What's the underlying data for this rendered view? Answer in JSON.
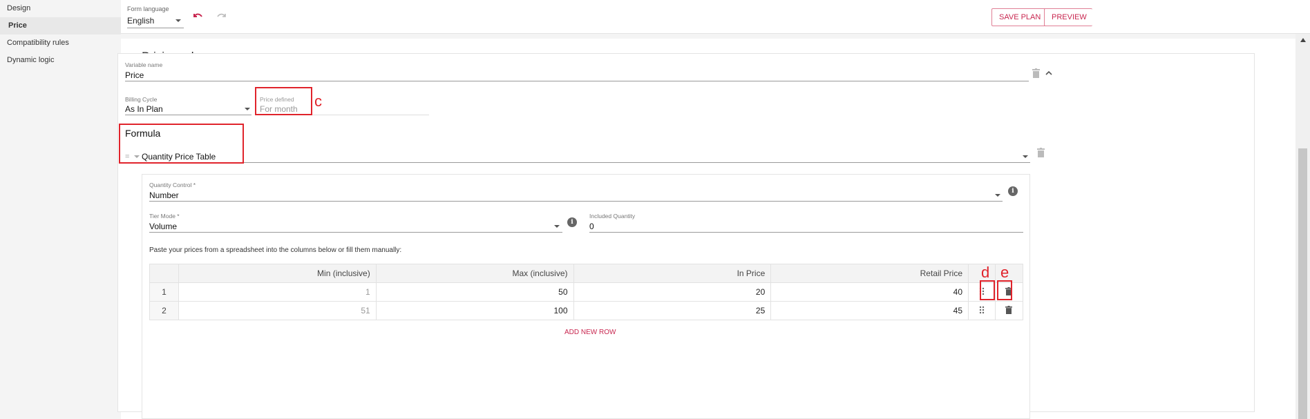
{
  "sidebar": {
    "items": [
      {
        "label": "Design"
      },
      {
        "label": "Price"
      },
      {
        "label": "Compatibility rules"
      },
      {
        "label": "Dynamic logic"
      }
    ]
  },
  "topbar": {
    "language_label": "Form language",
    "language_value": "English",
    "save_plan_label": "SAVE PLAN",
    "preview_label": "PREVIEW"
  },
  "main": {
    "title": "Pricing rules",
    "variable_label": "Variable name",
    "variable_value": "Price",
    "billing_label": "Billing Cycle",
    "billing_value": "As In Plan",
    "price_defined_label": "Price defined",
    "price_defined_value": "For month",
    "formula_title": "Formula",
    "formula_prefix": "=",
    "formula_value": "Quantity Price Table",
    "quantity_control_label": "Quantity Control *",
    "quantity_control_value": "Number",
    "tier_mode_label": "Tier Mode *",
    "tier_mode_value": "Volume",
    "included_qty_label": "Included Quantity",
    "included_qty_value": "0",
    "paste_note": "Paste your prices from a spreadsheet into the columns below or fill them manually:",
    "add_new_row": "ADD NEW ROW"
  },
  "table": {
    "headers": [
      "Min (inclusive)",
      "Max (inclusive)",
      "In Price",
      "Retail Price"
    ],
    "rows": [
      {
        "n": "1",
        "min": "1",
        "max": "50",
        "in": "20",
        "retail": "40"
      },
      {
        "n": "2",
        "min": "51",
        "max": "100",
        "in": "25",
        "retail": "45"
      }
    ]
  },
  "annotations": {
    "c": "c",
    "d": "d",
    "e": "e"
  },
  "colors": {
    "accent": "#c8264f",
    "annotation": "#e0232b"
  }
}
